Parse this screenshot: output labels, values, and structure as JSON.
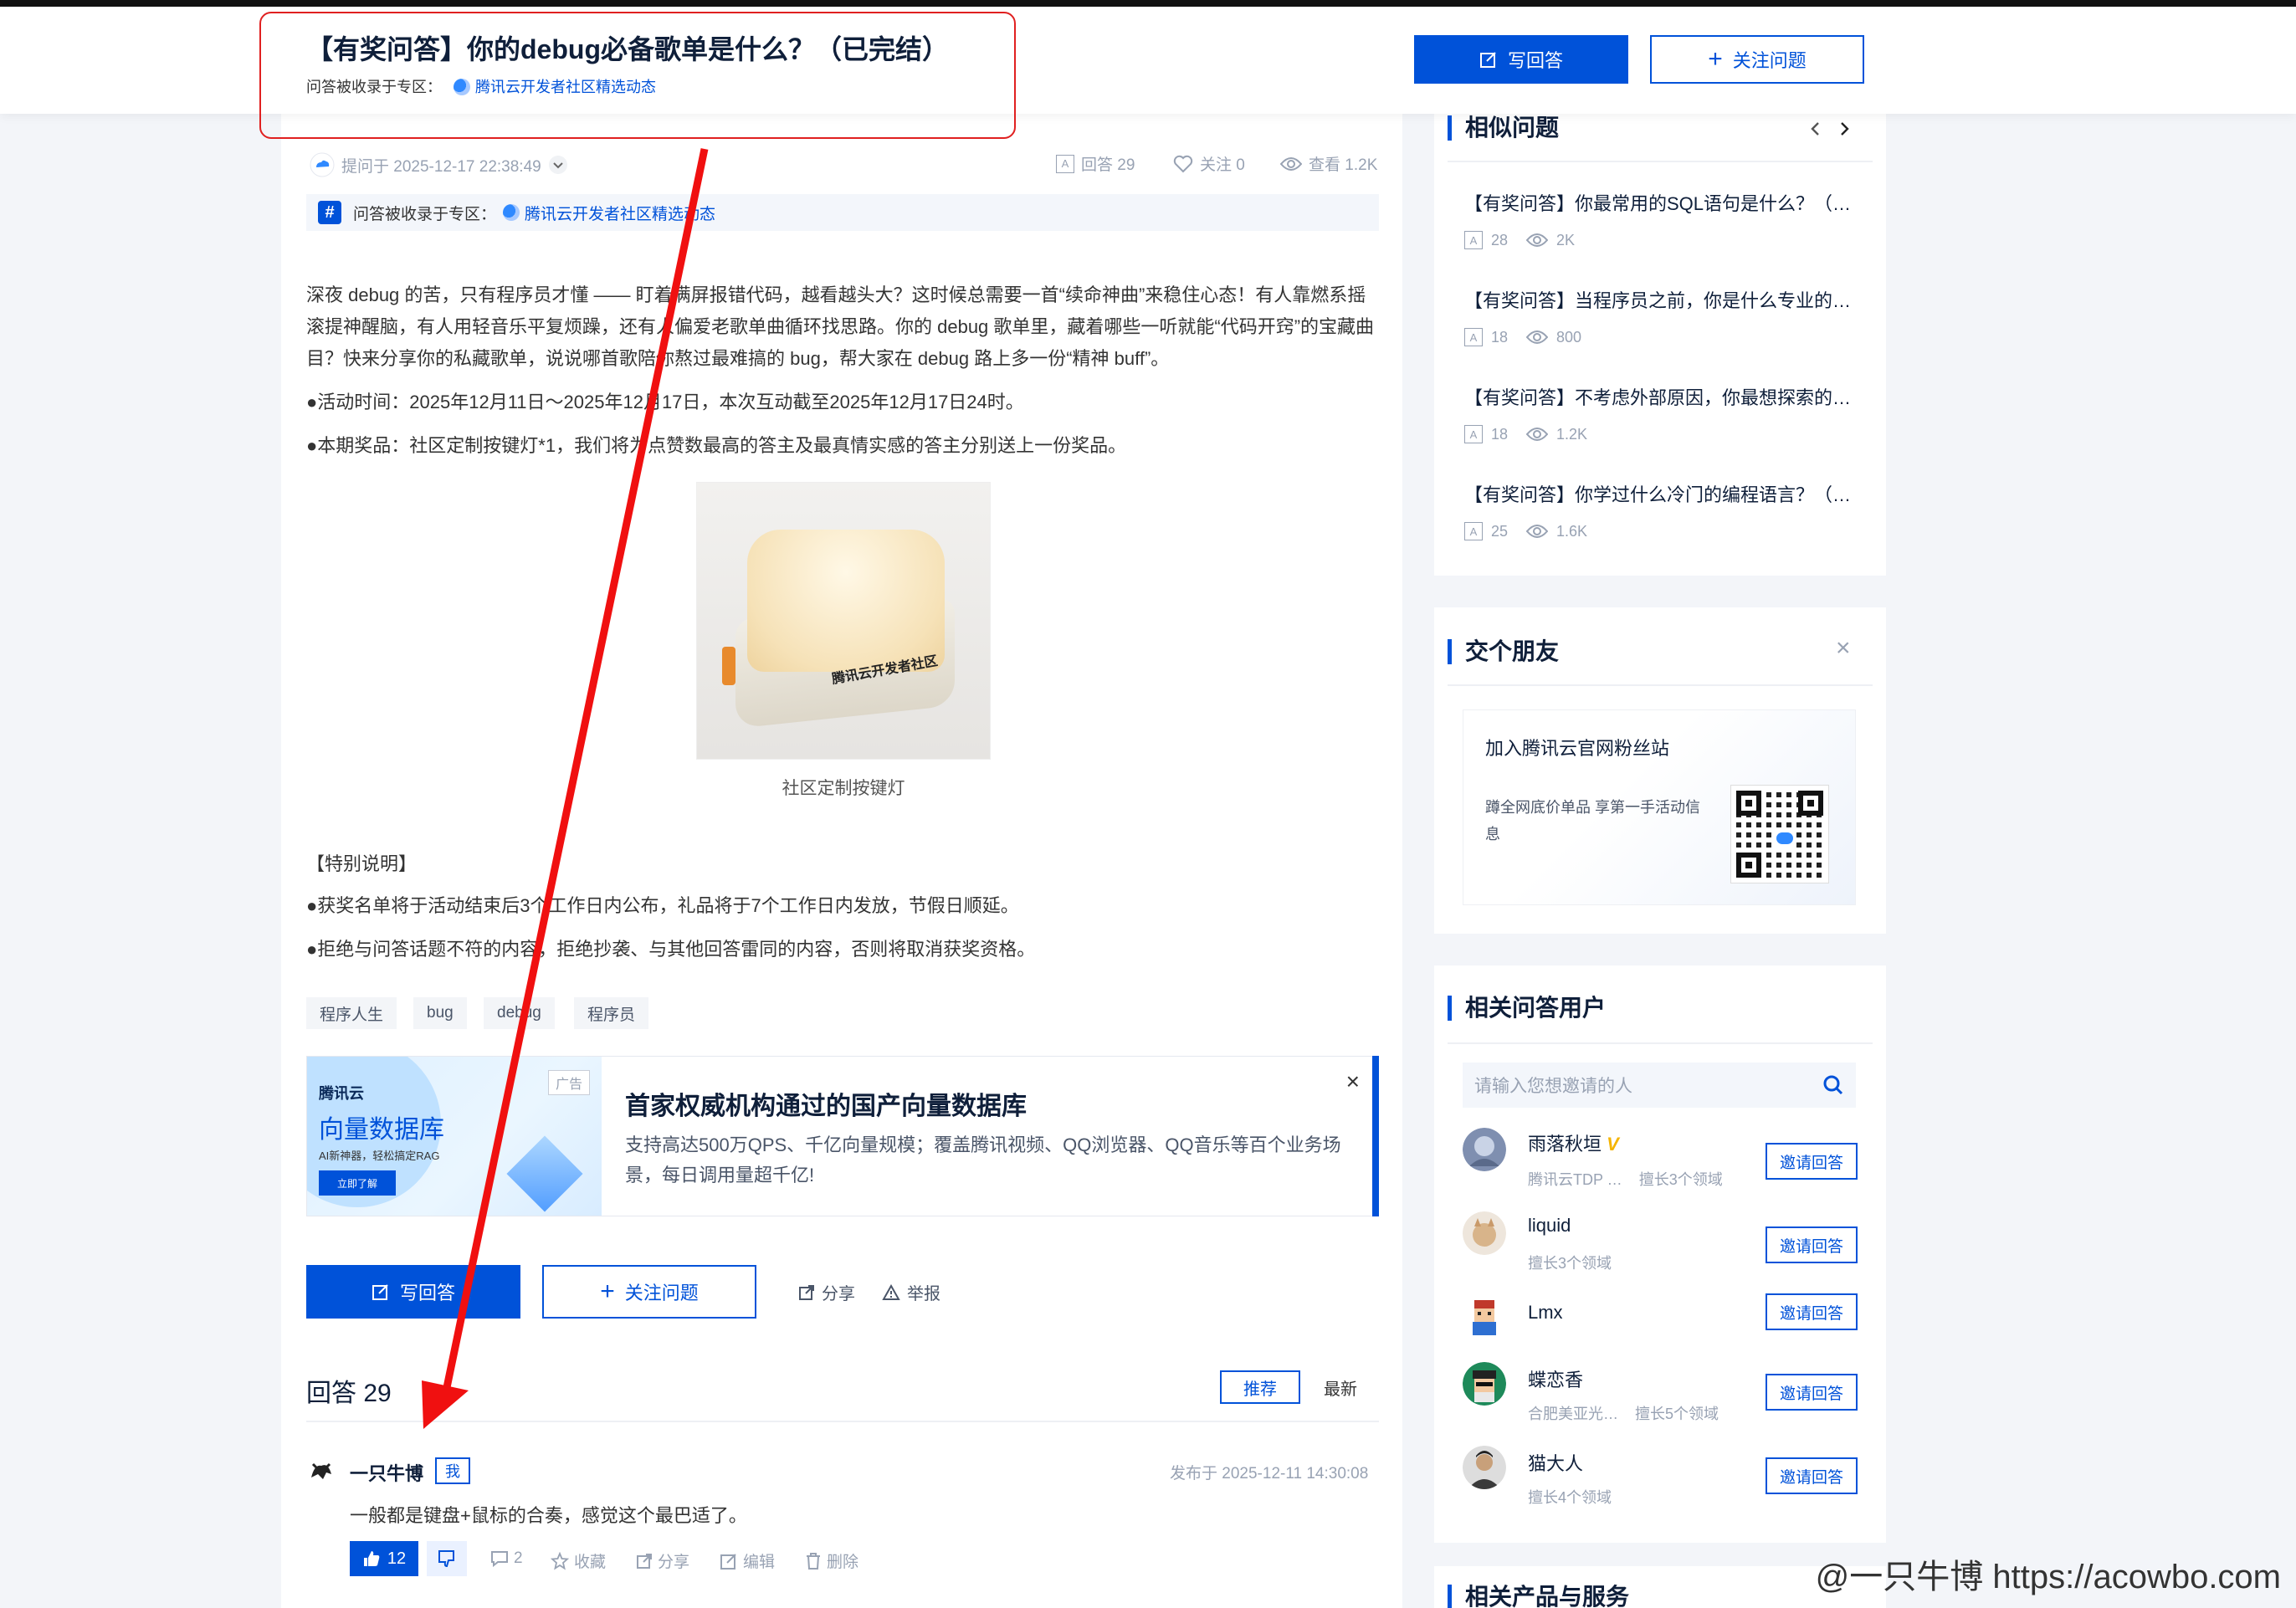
{
  "header": {
    "title": "【有奖问答】你的debug必备歌单是什么？（已完结）",
    "zone_label": "问答被收录于专区：",
    "zone_link": "腾讯云开发者社区精选动态",
    "write_answer": "写回答",
    "follow_question": "关注问题"
  },
  "question": {
    "asked_at": "提问于 2025-12-17 22:38:49",
    "answers_stat": "回答 29",
    "follow_stat": "关注 0",
    "views_stat": "查看 1.2K",
    "zone_label": "问答被收录于专区：",
    "zone_link": "腾讯云开发者社区精选动态",
    "intro": "深夜 debug 的苦，只有程序员才懂 —— 盯着满屏报错代码，越看越头大？这时候总需要一首“续命神曲”来稳住心态！有人靠燃系摇滚提神醒脑，有人用轻音乐平复烦躁，还有人偏爱老歌单曲循环找思路。你的 debug 歌单里，藏着哪些一听就能“代码开窍”的宝藏曲目？快来分享你的私藏歌单，说说哪首歌陪你熬过最难搞的 bug，帮大家在 debug 路上多一份“精神 buff”。",
    "time_line": "●活动时间：2025年12月11日～2025年12月17日，本次互动截至2025年12月17日24时。",
    "prize_line": "●本期奖品：社区定制按键灯*1，我们将为点赞数最高的答主及最真情实感的答主分别送上一份奖品。",
    "product_label": "腾讯云开发者社区",
    "image_caption": "社区定制按键灯",
    "special_title": "【特别说明】",
    "special_1": "●获奖名单将于活动结束后3个工作日内公布，礼品将于7个工作日内发放，节假日顺延。",
    "special_2": "●拒绝与问答话题不符的内容，拒绝抄袭、与其他回答雷同的内容，否则将取消获奖资格。",
    "tags": [
      "程序人生",
      "bug",
      "debug",
      "程序员"
    ]
  },
  "ad": {
    "brand": "腾讯云",
    "product": "向量数据库",
    "slogan": "AI新神器，轻松搞定RAG",
    "cta": "立即了解",
    "badge": "广告",
    "title": "首家权威机构通过的国产向量数据库",
    "desc": "支持高达500万QPS、千亿向量规模；覆盖腾讯视频、QQ浏览器、QQ音乐等百个业务场景，每日调用量超千亿!",
    "close": "×"
  },
  "actions": {
    "write_answer": "写回答",
    "follow_question": "关注问题",
    "share": "分享",
    "report": "举报"
  },
  "answers": {
    "heading": "回答 29",
    "sort_recommend": "推荐",
    "sort_latest": "最新",
    "items": [
      {
        "author": "一只牛博",
        "badge": "我",
        "date": "发布于 2025-12-11 14:30:08",
        "body": "一般都是键盘+鼠标的合奏，感觉这个最巴适了。",
        "likes": "12",
        "comments": "2",
        "collect": "收藏",
        "share": "分享",
        "edit": "编辑",
        "delete": "删除"
      }
    ]
  },
  "sidebar": {
    "similar_title": "相似问题",
    "similar": [
      {
        "q": "【有奖问答】你最常用的SQL语句是什么？（…",
        "answers": "28",
        "views": "2K"
      },
      {
        "q": "【有奖问答】当程序员之前，你是什么专业的…",
        "answers": "18",
        "views": "800"
      },
      {
        "q": "【有奖问答】不考虑外部原因，你最想探索的…",
        "answers": "18",
        "views": "1.2K"
      },
      {
        "q": "【有奖问答】你学过什么冷门的编程语言？（…",
        "answers": "25",
        "views": "1.6K"
      }
    ],
    "friends_title": "交个朋友",
    "friends_close": "×",
    "fans_title": "加入腾讯云官网粉丝站",
    "fans_desc": "蹲全网底价单品 享第一手活动信息",
    "users_title": "相关问答用户",
    "search_placeholder": "请输入您想邀请的人",
    "users": [
      {
        "name": "雨落秋垣",
        "v": "V",
        "sub1": "腾讯云TDP …",
        "sub2": "擅长3个领域",
        "invite": "邀请回答"
      },
      {
        "name": "liquid",
        "v": "",
        "sub1": "擅长3个领域",
        "sub2": "",
        "invite": "邀请回答"
      },
      {
        "name": "Lmx",
        "v": "",
        "sub1": "",
        "sub2": "",
        "invite": "邀请回答"
      },
      {
        "name": "蝶恋香",
        "v": "",
        "sub1": "合肥美亚光…",
        "sub2": "擅长5个领域",
        "invite": "邀请回答"
      },
      {
        "name": "猫大人",
        "v": "",
        "sub1": "擅长4个领域",
        "sub2": "",
        "invite": "邀请回答"
      }
    ],
    "products_title": "相关产品与服务"
  },
  "watermark": "@一只牛博 https://acowbo.com",
  "colors": {
    "accent": "#0052d9",
    "annotation": "#e02020"
  }
}
